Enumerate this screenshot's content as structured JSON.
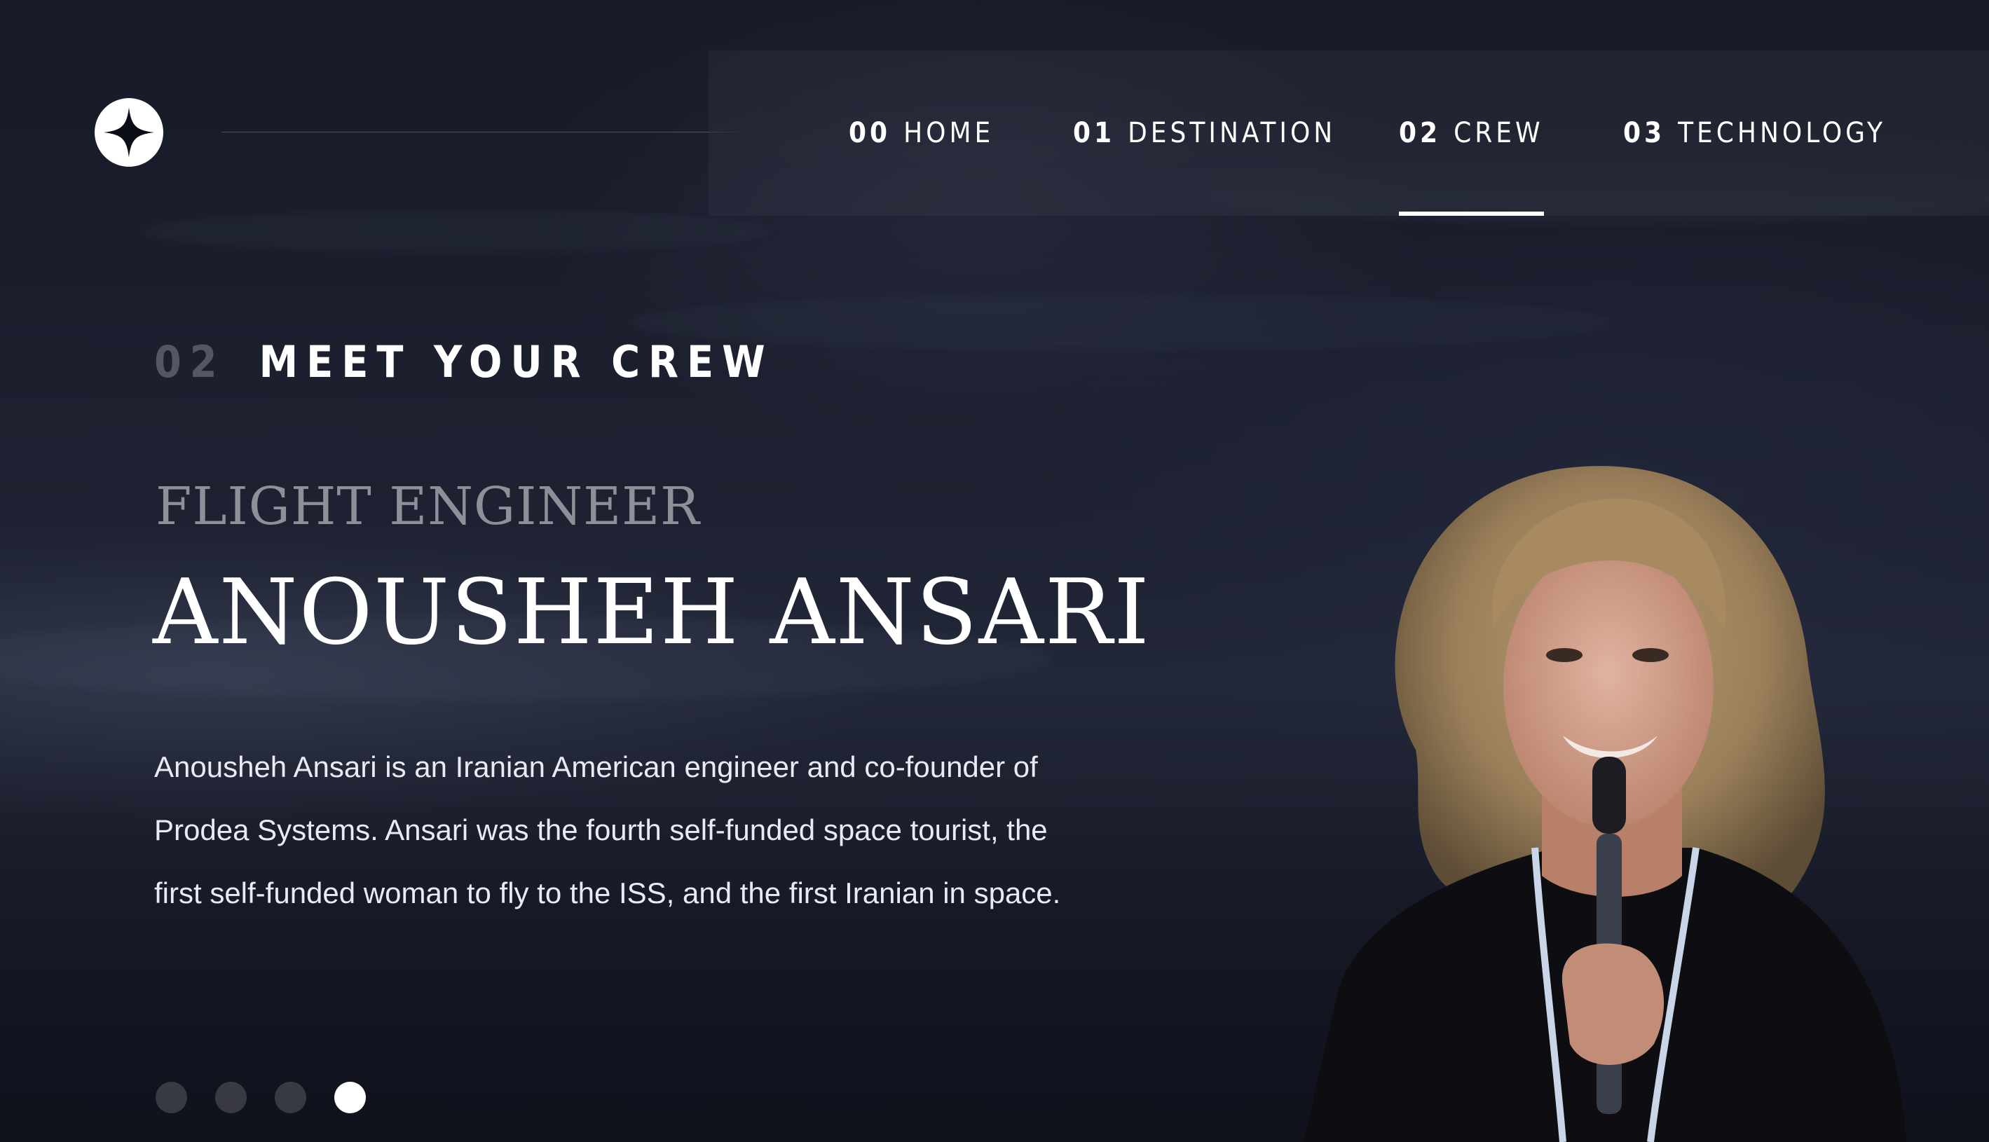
{
  "nav": {
    "items": [
      {
        "num": "00",
        "label": "HOME"
      },
      {
        "num": "01",
        "label": "DESTINATION"
      },
      {
        "num": "02",
        "label": "CREW"
      },
      {
        "num": "03",
        "label": "TECHNOLOGY"
      }
    ],
    "active_index": 2
  },
  "heading": {
    "num": "02",
    "text": "MEET YOUR CREW"
  },
  "crew": {
    "role": "FLIGHT ENGINEER",
    "name": "ANOUSHEH ANSARI",
    "bio": "Anousheh Ansari is an Iranian American engineer and co-founder of Prodea Systems. Ansari was the fourth self-funded space tourist, the first self-funded woman to fly to the ISS, and the first Iranian in space."
  },
  "slider": {
    "count": 4,
    "active_index": 3
  },
  "icons": {
    "logo": "star-logo-icon"
  },
  "colors": {
    "background": "#0b0d17",
    "text": "#ffffff",
    "accent": "#d0d6f9"
  }
}
